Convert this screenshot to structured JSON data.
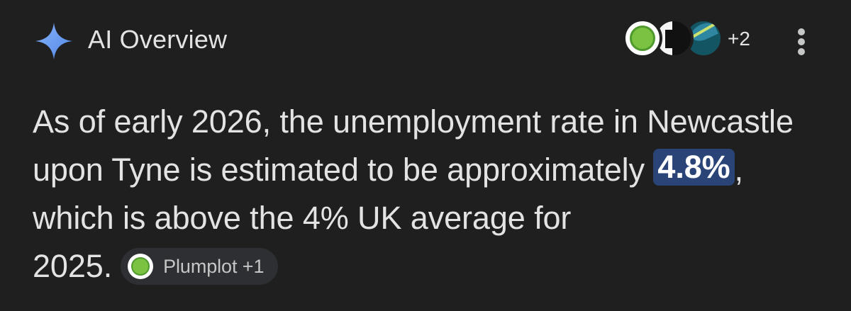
{
  "header": {
    "title": "AI Overview",
    "icon": "gemini-sparkle-icon",
    "sources_extra_count": "+2",
    "menu_icon": "more-vert-icon"
  },
  "answer": {
    "line1": "As of early 2026, the unemployment rate in Newcastle",
    "line2_before": "upon Tyne is estimated to be approximately ",
    "highlight": "4.8%",
    "line2_after": ",",
    "line3": "which is above the 4% UK average for",
    "line4": "2025."
  },
  "citation_chip": {
    "label": "Plumplot +1"
  },
  "colors": {
    "background": "#1f1f1f",
    "text": "#e3e3e3",
    "highlight_bg": "#2b4478",
    "chip_bg": "#2e2f33",
    "sparkle": "#6ea8fe"
  }
}
